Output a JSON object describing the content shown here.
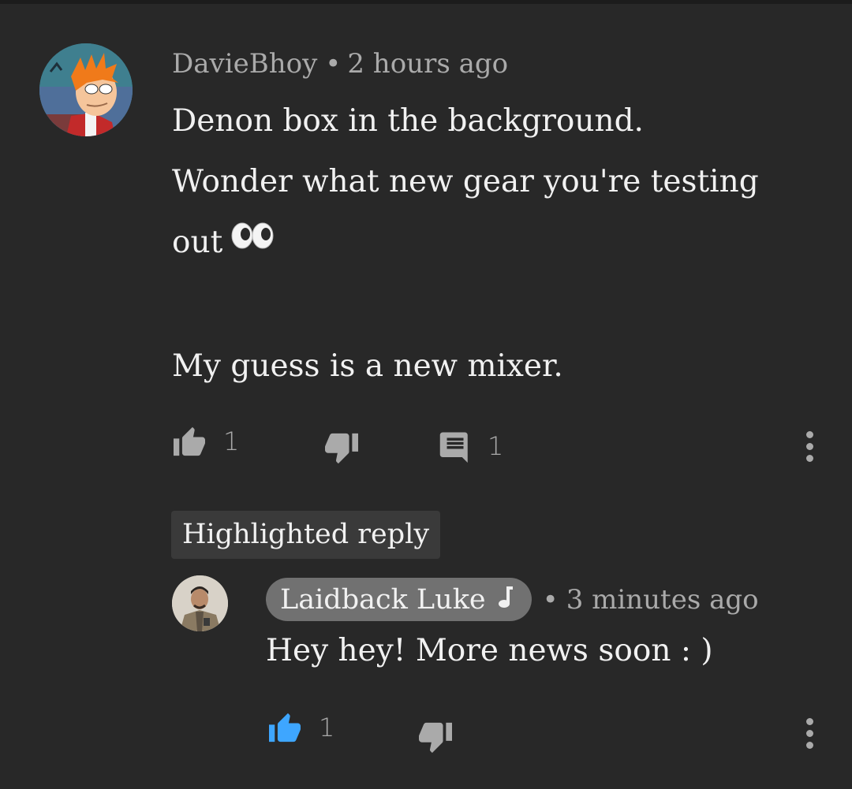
{
  "comment": {
    "author": "DavieBhoy",
    "separator": "•",
    "time": "2 hours ago",
    "lines": [
      "Denon box in the background.",
      "Wonder what new gear you're testing",
      "out"
    ],
    "emoji": "eyes-emoji",
    "last_line": "My guess is a new mixer.",
    "like_count": "1",
    "reply_count": "1"
  },
  "highlight": {
    "label": "Highlighted reply"
  },
  "reply": {
    "author": "Laidback Luke",
    "separator": "•",
    "time": "3 minutes ago",
    "text": "Hey hey! More news soon : )",
    "like_count": "1",
    "like_active": true
  },
  "colors": {
    "background": "#282828",
    "secondary_text": "#aaaaaa",
    "primary_text": "#f1f1f1",
    "active_like": "#3ea6ff",
    "author_chip": "#717171",
    "highlight_chip": "#3a3a3a"
  },
  "icons": {
    "like": "thumbs-up-icon",
    "dislike": "thumbs-down-icon",
    "reply": "comment-icon",
    "more": "more-vert-icon",
    "verified_artist": "music-note-icon"
  }
}
